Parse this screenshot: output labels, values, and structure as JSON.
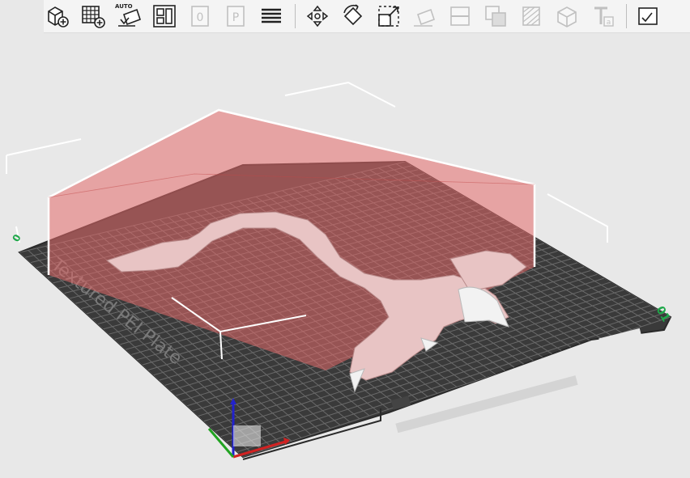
{
  "toolbar": {
    "auto_label": "AUTO",
    "buttons": [
      {
        "icon": "add-object-icon"
      },
      {
        "icon": "add-plate-icon"
      },
      {
        "icon": "auto-orient-icon"
      },
      {
        "icon": "arrange-icon"
      },
      {
        "icon": "import-0-icon",
        "disabled": true
      },
      {
        "icon": "import-p-icon",
        "disabled": true
      },
      {
        "icon": "layers-list-icon"
      },
      {
        "icon": "move-icon"
      },
      {
        "icon": "rotate-icon"
      },
      {
        "icon": "scale-icon"
      },
      {
        "icon": "lay-on-face-icon",
        "disabled": true
      },
      {
        "icon": "cut-icon",
        "disabled": true
      },
      {
        "icon": "mesh-boolean-icon",
        "disabled": true
      },
      {
        "icon": "paint-support-icon",
        "disabled": true
      },
      {
        "icon": "seam-paint-icon",
        "disabled": true
      },
      {
        "icon": "text-icon",
        "disabled": true
      },
      {
        "icon": "measure-icon"
      }
    ]
  },
  "bed": {
    "label": "Textured PEI Plate",
    "corner_label_left": "0",
    "corner_label_right": "01"
  },
  "colors": {
    "background": "#e8e8e8",
    "bed": "#3a3a3a",
    "grid": "#6a6a6a",
    "volume_fill": "#e36a6a",
    "model": "#e8c4c4",
    "axis_x": "#d12222",
    "axis_y": "#21a321",
    "axis_z": "#2222cc",
    "label_green": "#1fa84a"
  }
}
